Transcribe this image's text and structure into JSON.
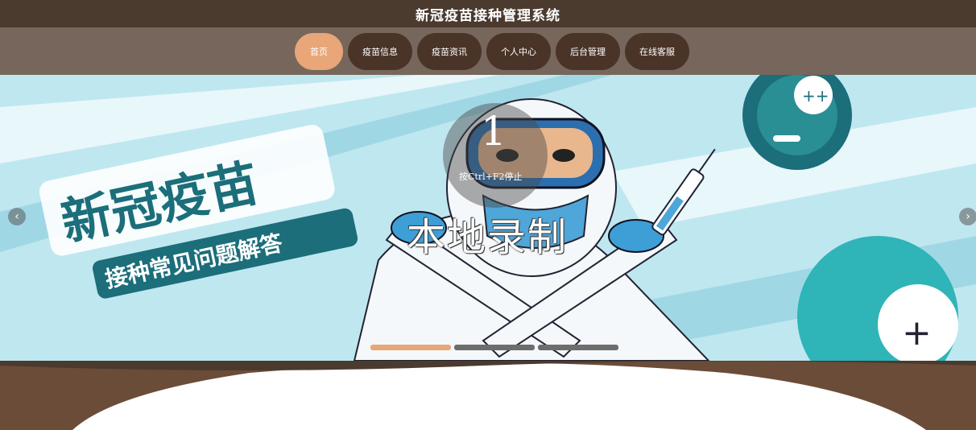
{
  "header": {
    "title": "新冠疫苗接种管理系统"
  },
  "nav": {
    "items": [
      {
        "label": "首页",
        "active": true
      },
      {
        "label": "疫苗信息",
        "active": false
      },
      {
        "label": "疫苗资讯",
        "active": false
      },
      {
        "label": "个人中心",
        "active": false
      },
      {
        "label": "后台管理",
        "active": false
      },
      {
        "label": "在线客服",
        "active": false
      }
    ]
  },
  "banner": {
    "headline": "新冠疫苗",
    "subheadline": "接种常见问题解答",
    "prev_icon": "chevron-left-icon",
    "next_icon": "chevron-right-icon",
    "slides_count": 3,
    "active_slide": 1
  },
  "recording_overlay": {
    "countdown": "1",
    "hint": "按Ctrl+F2停止",
    "title": "本地录制"
  },
  "colors": {
    "header_bg": "#4b3a2e",
    "nav_bg": "#76665b",
    "nav_item_bg": "#4a3427",
    "accent": "#e8a679",
    "banner_teal": "#1b6e7a"
  }
}
